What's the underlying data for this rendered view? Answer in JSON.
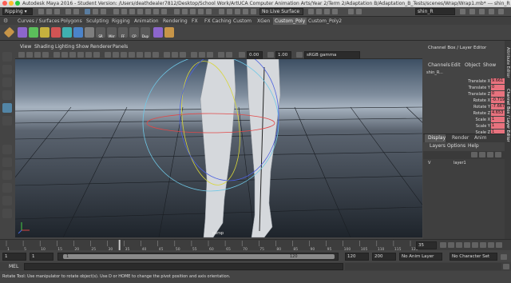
{
  "window": {
    "title": "Autodesk Maya 2016 - Student Version: /Users/deathdealer7812/Desktop/School Work/ArtUCA Computer Animation Arts/Year 2/Term 2/Adaptation B/Adaptation_B_Tests/scenes/Wrap/Wrap1.mb* --- shin_R"
  },
  "status_line": {
    "menu_set": "Ripping",
    "live_surface": "No Live Surface",
    "object_field": "shin_R"
  },
  "shelf": {
    "tabs": [
      "Curves / Surfaces",
      "Polygons",
      "Sculpting",
      "Rigging",
      "Animation",
      "Rendering",
      "FX",
      "FX Caching",
      "Custom",
      "XGen",
      "Custom_Poly",
      "Custom_Poly2"
    ],
    "active_tab": "Custom_Poly",
    "icon_labels": [
      "SR",
      "Mirr",
      "FF",
      "CP",
      "Dup"
    ],
    "colors": {
      "cube": "#c79548",
      "purple": "#8c66cc",
      "green": "#5bbf5b",
      "red": "#d15454",
      "blue": "#4b83c9",
      "teal": "#3fb0b0"
    }
  },
  "panel": {
    "menus": [
      "View",
      "Shading",
      "Lighting",
      "Show",
      "Renderer",
      "Panels"
    ],
    "exposure": "0.00",
    "gamma": "1.00",
    "color_space": "sRGB gamma",
    "camera_label": "persp"
  },
  "channel_box": {
    "menus": [
      "Channels",
      "Edit",
      "Object",
      "Show"
    ],
    "object_name": "shin_R...",
    "channels": [
      {
        "label": "Translate X",
        "value": "9.661"
      },
      {
        "label": "Translate Y",
        "value": "0"
      },
      {
        "label": "Translate Z",
        "value": "0"
      },
      {
        "label": "Rotate X",
        "value": "-0.719"
      },
      {
        "label": "Rotate Y",
        "value": "-7.667"
      },
      {
        "label": "Rotate Z",
        "value": "4.653"
      },
      {
        "label": "Scale X",
        "value": "1"
      },
      {
        "label": "Scale Y",
        "value": "1"
      },
      {
        "label": "Scale Z",
        "value": "1"
      }
    ],
    "side_tabs": [
      "Channel Box / Layer Editor",
      "Attribute Editor"
    ],
    "highlight_color": "#e8727e"
  },
  "layer_editor": {
    "tabs": [
      "Display",
      "Render",
      "Anim"
    ],
    "active_tab": "Display",
    "menus": [
      "Layers",
      "Options",
      "Help"
    ],
    "layers": [
      {
        "name": "layer1",
        "visible": "V"
      }
    ]
  },
  "timeline": {
    "ticks": [
      "1",
      "5",
      "10",
      "15",
      "20",
      "25",
      "30",
      "35",
      "40",
      "45",
      "50",
      "55",
      "60",
      "65",
      "70",
      "75",
      "80",
      "85",
      "90",
      "95",
      "100",
      "105",
      "110",
      "115",
      "120"
    ],
    "current_frame": "35",
    "current_frame_fraction": 0.28
  },
  "range_bar": {
    "start": "1",
    "playback_start": "1",
    "slider_start": "1",
    "slider_end": "120",
    "playback_end": "120",
    "end": "200",
    "anim_layer": "No Anim Layer",
    "character_set": "No Character Set"
  },
  "command_line": {
    "label": "MEL"
  },
  "help_line": {
    "text": "Rotate Tool: Use manipulator to rotate object(s). Use D or HOME to change the pivot position and axis orientation."
  }
}
